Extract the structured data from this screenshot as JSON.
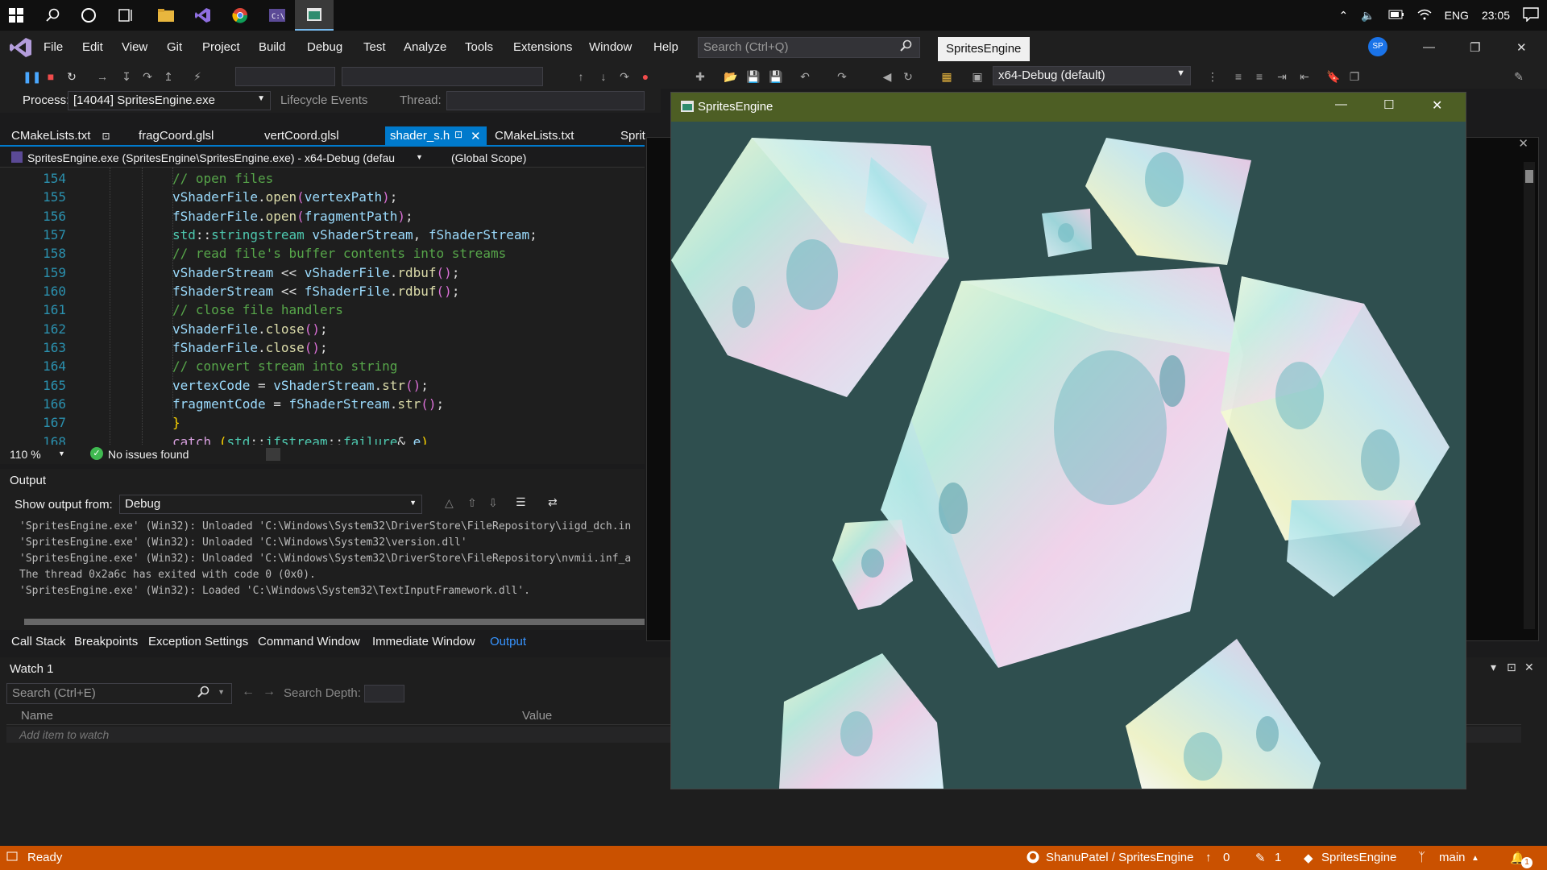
{
  "taskbar": {
    "tray": {
      "language": "ENG",
      "time": "23:05"
    }
  },
  "menu": {
    "items": [
      "File",
      "Edit",
      "View",
      "Git",
      "Project",
      "Build",
      "Debug",
      "Test",
      "Analyze",
      "Tools",
      "Extensions",
      "Window",
      "Help"
    ],
    "search_placeholder": "Search (Ctrl+Q)",
    "solution_name": "SpritesEngine",
    "avatar_initials": "SP"
  },
  "toolbar": {
    "config": "x64-Debug (default)"
  },
  "process_bar": {
    "process_label": "Process:",
    "process_value": "[14044] SpritesEngine.exe",
    "lifecycle_label": "Lifecycle Events",
    "thread_label": "Thread:"
  },
  "tabs": [
    {
      "label": "CMakeLists.txt"
    },
    {
      "label": "fragCoord.glsl"
    },
    {
      "label": "vertCoord.glsl"
    },
    {
      "label": "shader_s.h"
    },
    {
      "label": "CMakeLists.txt"
    },
    {
      "label": "Sprit"
    }
  ],
  "nav": {
    "target": "SpritesEngine.exe (SpritesEngine\\SpritesEngine.exe) - x64-Debug (defau",
    "scope": "(Global Scope)"
  },
  "editor": {
    "line_numbers": [
      "154",
      "155",
      "156",
      "157",
      "158",
      "159",
      "160",
      "161",
      "162",
      "163",
      "164",
      "165",
      "166",
      "167",
      "168"
    ],
    "zoom": "110 %",
    "issues": "No issues found"
  },
  "output": {
    "title": "Output",
    "show_from_label": "Show output from:",
    "show_from_value": "Debug",
    "lines": [
      "'SpritesEngine.exe' (Win32): Unloaded 'C:\\Windows\\System32\\DriverStore\\FileRepository\\iigd_dch.in",
      "'SpritesEngine.exe' (Win32): Unloaded 'C:\\Windows\\System32\\version.dll'",
      "'SpritesEngine.exe' (Win32): Unloaded 'C:\\Windows\\System32\\DriverStore\\FileRepository\\nvmii.inf_a",
      "The thread 0x2a6c has exited with code 0 (0x0).",
      "'SpritesEngine.exe' (Win32): Loaded 'C:\\Windows\\System32\\TextInputFramework.dll'."
    ]
  },
  "bottom_tabs": [
    "Call Stack",
    "Breakpoints",
    "Exception Settings",
    "Command Window",
    "Immediate Window",
    "Output"
  ],
  "watch": {
    "title": "Watch 1",
    "search_placeholder": "Search (Ctrl+E)",
    "search_depth_label": "Search Depth:",
    "col_name": "Name",
    "col_value": "Value",
    "add_item": "Add item to watch"
  },
  "sprite_window": {
    "title": "SpritesEngine",
    "background_color": "#2f4f4f"
  },
  "status": {
    "ready": "Ready",
    "repo": "ShanuPatel / SpritesEngine",
    "up_count": "0",
    "edit_count": "1",
    "project": "SpritesEngine",
    "branch": "main",
    "notifications": "1"
  }
}
